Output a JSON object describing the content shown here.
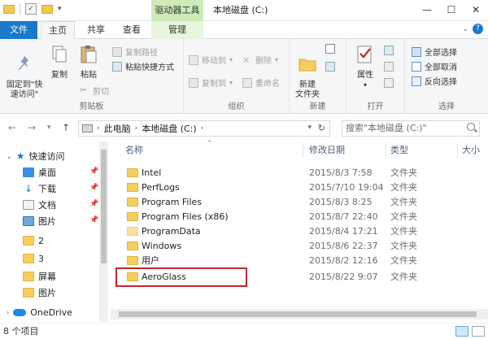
{
  "window": {
    "context_tab": "驱动器工具",
    "title": "本地磁盘 (C:)",
    "controls": [
      "minimize",
      "maximize",
      "close"
    ]
  },
  "tabs": [
    {
      "label": "文件"
    },
    {
      "label": "主页"
    },
    {
      "label": "共享"
    },
    {
      "label": "查看"
    },
    {
      "label": "管理"
    }
  ],
  "ribbon": {
    "clipboard": {
      "label": "剪贴板",
      "pin_quick_access": "固定到\"快\n速访问\"",
      "copy": "复制",
      "paste": "粘贴",
      "copy_path": "复制路径",
      "paste_shortcut": "粘贴快捷方式",
      "cut": "剪切"
    },
    "organize": {
      "label": "组织",
      "move_to": "移动到",
      "copy_to": "复制到",
      "delete": "删除",
      "rename": "重命名"
    },
    "new": {
      "label": "新建",
      "new_folder": "新建\n文件夹"
    },
    "open": {
      "label": "打开",
      "properties": "属性"
    },
    "select": {
      "label": "选择",
      "select_all": "全部选择",
      "select_none": "全部取消",
      "invert": "反向选择"
    }
  },
  "address": {
    "crumbs": [
      "此电脑",
      "本地磁盘 (C:)"
    ],
    "search_placeholder": "搜索\"本地磁盘 (C:)\""
  },
  "nav_pane": [
    {
      "label": "快速访问",
      "icon": "star-icon",
      "pinned": false
    },
    {
      "label": "桌面",
      "icon": "desktop-icon",
      "pinned": true
    },
    {
      "label": "下载",
      "icon": "download-icon",
      "pinned": true
    },
    {
      "label": "文档",
      "icon": "document-icon",
      "pinned": true
    },
    {
      "label": "图片",
      "icon": "picture-icon",
      "pinned": true
    },
    {
      "label": "2",
      "icon": "folder-icon",
      "pinned": false
    },
    {
      "label": "3",
      "icon": "folder-icon",
      "pinned": false
    },
    {
      "label": "屏幕",
      "icon": "folder-icon",
      "pinned": false
    },
    {
      "label": "图片",
      "icon": "folder-icon",
      "pinned": false
    },
    {
      "label": "OneDrive",
      "icon": "onedrive-icon",
      "pinned": false
    }
  ],
  "columns": {
    "name": "名称",
    "date": "修改日期",
    "type": "类型",
    "size": "大小"
  },
  "files": [
    {
      "name": "Intel",
      "date": "2015/8/3 7:58",
      "type": "文件夹"
    },
    {
      "name": "PerfLogs",
      "date": "2015/7/10 19:04",
      "type": "文件夹"
    },
    {
      "name": "Program Files",
      "date": "2015/8/3 8:25",
      "type": "文件夹"
    },
    {
      "name": "Program Files (x86)",
      "date": "2015/8/7 22:40",
      "type": "文件夹"
    },
    {
      "name": "ProgramData",
      "date": "2015/8/4 17:21",
      "type": "文件夹"
    },
    {
      "name": "Windows",
      "date": "2015/8/6 22:37",
      "type": "文件夹"
    },
    {
      "name": "用户",
      "date": "2015/8/2 12:16",
      "type": "文件夹"
    },
    {
      "name": "AeroGlass",
      "date": "2015/8/22 9:07",
      "type": "文件夹"
    }
  ],
  "status": {
    "item_count": "8 个项目"
  },
  "colors": {
    "file_tab": "#1979ca",
    "context_tab": "#ccebb8",
    "highlight_box": "#c0272d",
    "folder": "#f6cf5b"
  }
}
